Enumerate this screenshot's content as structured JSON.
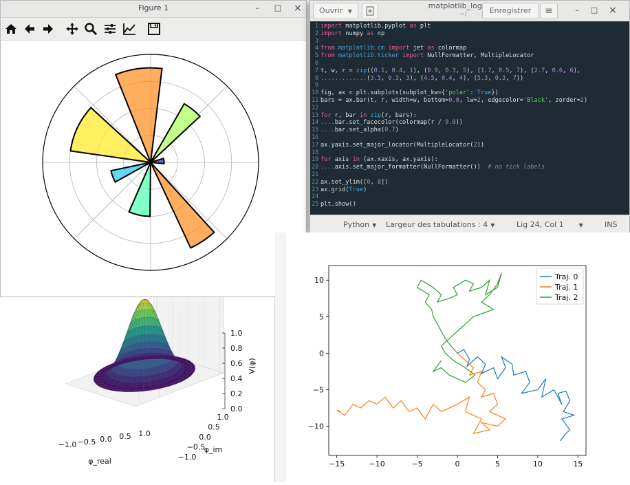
{
  "figure_window": {
    "title": "Figure 1",
    "controls": {
      "minimize": "–",
      "maximize": "□",
      "close": "×"
    },
    "toolbar": [
      "home-icon",
      "back-icon",
      "forward-icon",
      "pan-icon",
      "zoom-icon",
      "configure-subplots-icon",
      "edit-curves-icon",
      "save-icon"
    ]
  },
  "polar_chart": {
    "chart_data": {
      "type": "bar-polar",
      "rlim": [
        0,
        8
      ],
      "grid": true,
      "tick_labels": "none",
      "bars": [
        {
          "theta": 0.1,
          "width": 0.4,
          "r": 1,
          "color": "#2d2aa6"
        },
        {
          "theta": 0.9,
          "width": 0.3,
          "r": 5,
          "color": "#a9ff59"
        },
        {
          "theta": 1.7,
          "width": 0.5,
          "r": 7,
          "color": "#ff8a1a"
        },
        {
          "theta": 2.7,
          "width": 0.6,
          "r": 6,
          "color": "#ffe81e"
        },
        {
          "theta": 3.5,
          "width": 0.3,
          "r": 3,
          "color": "#20c8f0"
        },
        {
          "theta": 4.5,
          "width": 0.4,
          "r": 4,
          "color": "#4dffb0"
        },
        {
          "theta": 5.3,
          "width": 0.3,
          "r": 7,
          "color": "#ff8a1a"
        }
      ],
      "edge_color": "#000000",
      "alpha": 0.7
    }
  },
  "editor": {
    "open_label": "Ouvrir",
    "filename": "matplotlib_logo.py",
    "path": "~/",
    "save_label": "Enregistrer",
    "controls": {
      "minimize": "–",
      "maximize": "□",
      "close": "×"
    },
    "lines": [
      {
        "n": "1",
        "text": "import matplotlib.pyplot as plt"
      },
      {
        "n": "2",
        "text": "import numpy as np"
      },
      {
        "n": "3",
        "text": ""
      },
      {
        "n": "4",
        "text": "from matplotlib.cm import jet as colormap"
      },
      {
        "n": "5",
        "text": "from matplotlib.ticker import NullFormatter, MultipleLocator"
      },
      {
        "n": "6",
        "text": ""
      },
      {
        "n": "7",
        "text": "t, w, r = zip((0.1, 0.4, 1), (0.9, 0.3, 5), (1.7, 0.5, 7), (2.7, 0.6, 6),"
      },
      {
        "n": "8",
        "text": ".............(3.5, 0.3, 3), (4.5, 0.4, 4), (5.3, 0.3, 7))"
      },
      {
        "n": "9",
        "text": ""
      },
      {
        "n": "10",
        "text": "fig, ax = plt.subplots(subplot_kw={'polar': True})"
      },
      {
        "n": "11",
        "text": "bars = ax.bar(t, r, width=w, bottom=0.0, lw=2, edgecolor='Black', zorder=2)"
      },
      {
        "n": "12",
        "text": ""
      },
      {
        "n": "13",
        "text": "for r, bar in zip(r, bars):"
      },
      {
        "n": "14",
        "text": "....bar.set_facecolor(colormap(r / 9.0))"
      },
      {
        "n": "15",
        "text": "....bar.set_alpha(0.7)"
      },
      {
        "n": "16",
        "text": ""
      },
      {
        "n": "17",
        "text": "ax.yaxis.set_major_locator(MultipleLocator(2))"
      },
      {
        "n": "18",
        "text": ""
      },
      {
        "n": "19",
        "text": "for axis in (ax.xaxis, ax.yaxis):"
      },
      {
        "n": "20",
        "text": "....axis.set_major_formatter(NullFormatter())  # no tick labels"
      },
      {
        "n": "21",
        "text": ""
      },
      {
        "n": "22",
        "text": "ax.set_ylim([0, 8])"
      },
      {
        "n": "23",
        "text": "ax.grid(True)"
      },
      {
        "n": "24",
        "text": ""
      },
      {
        "n": "25",
        "text": "plt.show()"
      }
    ],
    "status": {
      "language": "Python",
      "tab_width": "Largeur des tabulations : 4",
      "cursor": "Lig 24, Col 1",
      "mode": "INS"
    }
  },
  "surface_chart": {
    "chart_data": {
      "type": "surface3d",
      "xlabel": "φ_real",
      "ylabel": "φ_im",
      "zlabel": "V(φ)",
      "x_ticks": [
        "−1.0",
        "−0.5",
        "0.0",
        "0.5",
        "1.0"
      ],
      "y_ticks": [
        "−1.0",
        "−0.5",
        "0.0",
        "0.5",
        "1.0"
      ],
      "z_ticks": [
        "0.0",
        "0.2",
        "0.4",
        "0.6",
        "0.8",
        "1.0"
      ],
      "colormap": "viridis"
    }
  },
  "trajectory_chart": {
    "chart_data": {
      "type": "line",
      "xlim": [
        -16,
        16
      ],
      "ylim": [
        -14,
        12
      ],
      "x_ticks": [
        "−15",
        "−10",
        "−5",
        "0",
        "5",
        "10",
        "15"
      ],
      "y_ticks": [
        "10",
        "5",
        "0",
        "−5",
        "−10"
      ],
      "legend": "top-right",
      "series": [
        {
          "name": "Traj. 0",
          "color": "#1f77b4",
          "x": [
            0,
            0.8,
            1.5,
            1.2,
            2.5,
            3.5,
            3,
            4.5,
            5,
            6,
            5.5,
            6.8,
            7,
            8.5,
            9,
            8,
            10,
            11,
            10.5,
            12,
            13,
            12.5,
            13.5,
            14,
            13.2,
            14.5,
            13,
            14,
            13.5,
            12.8
          ],
          "y": [
            0,
            0.5,
            -0.8,
            -1.8,
            -0.5,
            -1.5,
            -2.8,
            -2,
            -3.5,
            -2,
            -0.5,
            -1.5,
            -3,
            -2.5,
            -4,
            -5.5,
            -5,
            -3.5,
            -6,
            -5,
            -7,
            -5.5,
            -5.2,
            -6.5,
            -8,
            -8.5,
            -9,
            -10.5,
            -11,
            -12
          ]
        },
        {
          "name": "Traj. 1",
          "color": "#ff7f0e",
          "x": [
            0,
            1,
            2,
            1.5,
            3,
            2.5,
            3.5,
            3,
            4.5,
            5,
            4,
            6,
            5,
            3,
            4,
            2,
            3,
            1,
            1.5,
            0,
            -2,
            -3,
            -4,
            -5,
            -6,
            -7,
            -8,
            -9,
            -10,
            -11,
            -12,
            -13,
            -14,
            -15,
            -14.5
          ],
          "y": [
            0,
            -1,
            -2,
            -3,
            -2.5,
            -4,
            -5,
            -6,
            -5.5,
            -7,
            -8,
            -9,
            -10,
            -9.5,
            -10.5,
            -11,
            -9,
            -8,
            -6,
            -7,
            -8,
            -7,
            -9,
            -7.5,
            -8,
            -6.5,
            -7.5,
            -6,
            -7,
            -6.5,
            -7.5,
            -7,
            -8.5,
            -7.8,
            -8
          ]
        },
        {
          "name": "Traj. 2",
          "color": "#2ca02c",
          "x": [
            0,
            -0.8,
            -1.5,
            -2,
            -2.5,
            -3,
            -3.2,
            -4,
            -3.5,
            -5,
            -4.5,
            -3,
            -2,
            -2.5,
            -1,
            0,
            -0.5,
            1,
            2,
            1.5,
            3,
            4,
            3.5,
            5,
            5.5,
            5,
            4,
            3,
            4.5,
            2,
            1,
            0,
            -1,
            -2,
            -1.5,
            -0.5,
            1,
            2.2,
            1,
            -1,
            -2,
            -3,
            -2
          ],
          "y": [
            0,
            1,
            2,
            3,
            4,
            5,
            6,
            7,
            8,
            9,
            10,
            9,
            8,
            7,
            7.5,
            8,
            9,
            10,
            9.5,
            8.5,
            9,
            10,
            8,
            9,
            11,
            9.5,
            8,
            7,
            6,
            5,
            4,
            3,
            2,
            1,
            0,
            -1,
            -2,
            -3,
            -4,
            -3,
            -2,
            -2.5,
            -1
          ]
        }
      ]
    }
  }
}
